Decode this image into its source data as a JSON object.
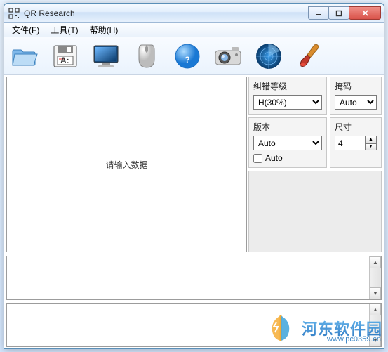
{
  "title": "QR Research",
  "menu": {
    "file": "文件(F)",
    "tools": "工具(T)",
    "help": "帮助(H)"
  },
  "main": {
    "placeholder": "请输入数据"
  },
  "panel": {
    "ecc": {
      "label": "纠错等级",
      "value": "H(30%)"
    },
    "mask": {
      "label": "掩码",
      "value": "Auto"
    },
    "version": {
      "label": "版本",
      "value": "Auto",
      "auto_label": "Auto"
    },
    "size": {
      "label": "尺寸",
      "value": "4"
    }
  },
  "watermark": {
    "brand": "河东软件园",
    "url": "www.pc0359.cn"
  }
}
